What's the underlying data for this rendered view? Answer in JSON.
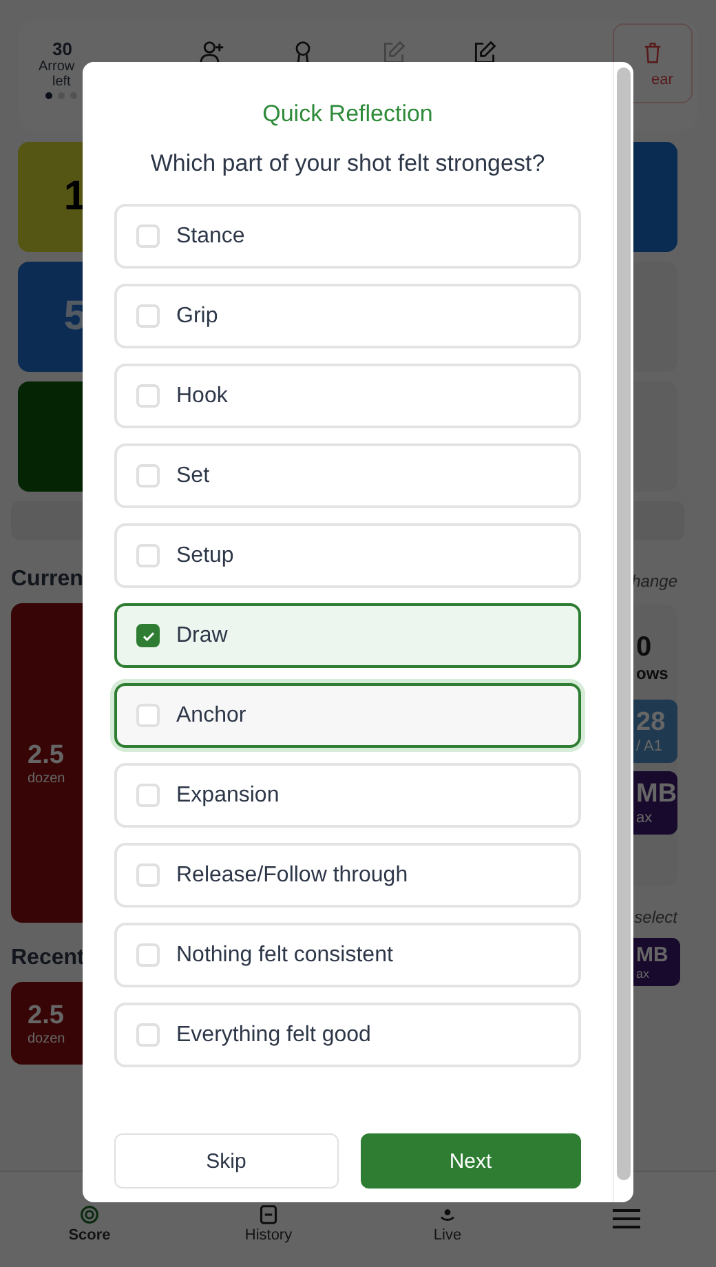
{
  "header": {
    "count": "30",
    "label_1": "Arrow",
    "label_2": "left",
    "dots": [
      {
        "selected": true
      },
      {
        "selected": false
      },
      {
        "selected": false
      }
    ],
    "tools": [
      {
        "kind": "add-person",
        "disabled": false
      },
      {
        "kind": "ribbon",
        "disabled": false
      },
      {
        "kind": "edit",
        "disabled": true
      },
      {
        "kind": "edit",
        "disabled": false
      }
    ],
    "clear_label": "ear"
  },
  "left_column": {
    "tiles": [
      {
        "kind": "number",
        "value": "1"
      },
      {
        "kind": "number",
        "value": "5"
      },
      {
        "kind": "blank"
      }
    ],
    "current_heading": "Curren",
    "current_value": "2.5",
    "current_unit": "dozen",
    "recent_heading": "Recent",
    "recent_value": "2.5",
    "recent_unit": "dozen"
  },
  "right_column": {
    "change_link": "hange",
    "arrows_value": "0",
    "arrows_label": "ows",
    "end_value": "28",
    "end_label": "/ A1",
    "max_value": "MB",
    "max_label": "ax",
    "select_link": "select",
    "recent_max_value": "MB",
    "recent_max_label": "ax"
  },
  "dialog": {
    "title": "Quick Reflection",
    "question": "Which part of your shot felt strongest?",
    "options": [
      {
        "label": "Stance",
        "checked": false,
        "focused": false
      },
      {
        "label": "Grip",
        "checked": false,
        "focused": false
      },
      {
        "label": "Hook",
        "checked": false,
        "focused": false
      },
      {
        "label": "Set",
        "checked": false,
        "focused": false
      },
      {
        "label": "Setup",
        "checked": false,
        "focused": false
      },
      {
        "label": "Draw",
        "checked": true,
        "focused": false
      },
      {
        "label": "Anchor",
        "checked": false,
        "focused": true
      },
      {
        "label": "Expansion",
        "checked": false,
        "focused": false
      },
      {
        "label": "Release/Follow through",
        "checked": false,
        "focused": false
      },
      {
        "label": "Nothing felt consistent",
        "checked": false,
        "focused": false
      },
      {
        "label": "Everything felt good",
        "checked": false,
        "focused": false
      }
    ],
    "buttons": {
      "skip": "Skip",
      "next": "Next"
    }
  },
  "nav": [
    {
      "kind": "score",
      "label": "Score",
      "selected": true
    },
    {
      "kind": "history",
      "label": "History",
      "selected": false
    },
    {
      "kind": "live",
      "label": "Live",
      "selected": false
    },
    {
      "kind": "menu",
      "selected": false
    }
  ]
}
